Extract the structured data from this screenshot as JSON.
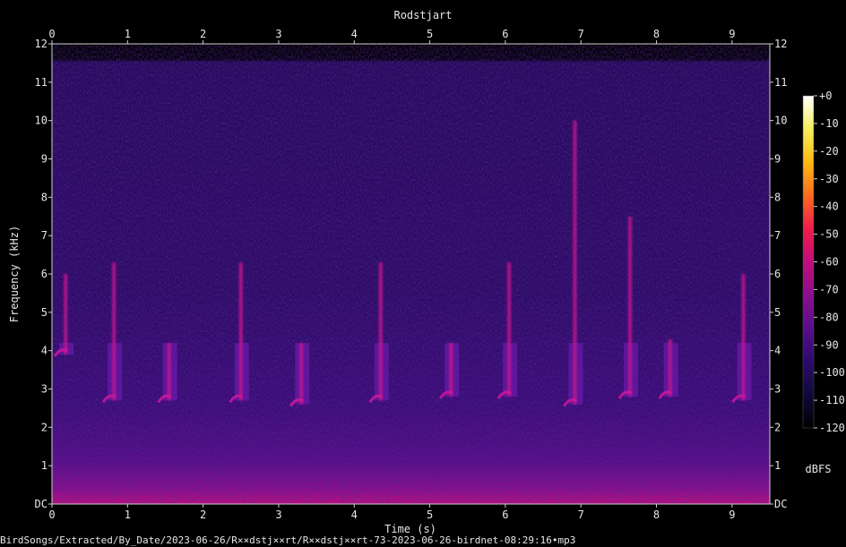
{
  "chart_data": {
    "type": "heatmap",
    "title": "Rodstjart",
    "xlabel": "Time (s)",
    "ylabel": "Frequency (kHz)",
    "xlim": [
      0,
      9.5
    ],
    "ylim": [
      0,
      12
    ],
    "x_ticks": [
      "0",
      "1",
      "2",
      "3",
      "4",
      "5",
      "6",
      "7",
      "8",
      "9"
    ],
    "y_ticks": [
      "DC",
      "1",
      "2",
      "3",
      "4",
      "5",
      "6",
      "7",
      "8",
      "9",
      "10",
      "11",
      "12"
    ],
    "colorbar": {
      "label": "dBFS",
      "ticks": [
        "+0",
        "-10",
        "-20",
        "-30",
        "-40",
        "-50",
        "-60",
        "-70",
        "-80",
        "-90",
        "-100",
        "-110",
        "-120"
      ],
      "range": [
        -120,
        0
      ],
      "colors": [
        "#000000",
        "#10093a",
        "#2b0a6e",
        "#5a0d8c",
        "#8a0f8f",
        "#c10e7a",
        "#ef1d4a",
        "#fb6a1d",
        "#fcb914",
        "#f6ee5a",
        "#ffffff"
      ]
    },
    "background_level_dbfs": -100,
    "signal_top_khz": 11.6,
    "syllables": [
      {
        "t": 0.18,
        "f_low": 3.9,
        "f_high": 6.0
      },
      {
        "t": 0.82,
        "f_low": 2.7,
        "f_high": 6.3
      },
      {
        "t": 1.55,
        "f_low": 2.7,
        "f_high": 4.2
      },
      {
        "t": 2.5,
        "f_low": 2.7,
        "f_high": 6.3
      },
      {
        "t": 3.3,
        "f_low": 2.6,
        "f_high": 4.2
      },
      {
        "t": 4.35,
        "f_low": 2.7,
        "f_high": 6.3
      },
      {
        "t": 5.28,
        "f_low": 2.8,
        "f_high": 4.2
      },
      {
        "t": 6.05,
        "f_low": 2.8,
        "f_high": 6.3
      },
      {
        "t": 6.92,
        "f_low": 2.6,
        "f_high": 10.0
      },
      {
        "t": 7.65,
        "f_low": 2.8,
        "f_high": 7.5
      },
      {
        "t": 8.18,
        "f_low": 2.8,
        "f_high": 4.3
      },
      {
        "t": 9.15,
        "f_low": 2.7,
        "f_high": 6.0
      }
    ]
  },
  "footer": {
    "caption": "BirdSongs/Extracted/By_Date/2023-06-26/R××dstj××rt/R××dstj××rt-73-2023-06-26-birdnet-08:29:16•mp3"
  }
}
